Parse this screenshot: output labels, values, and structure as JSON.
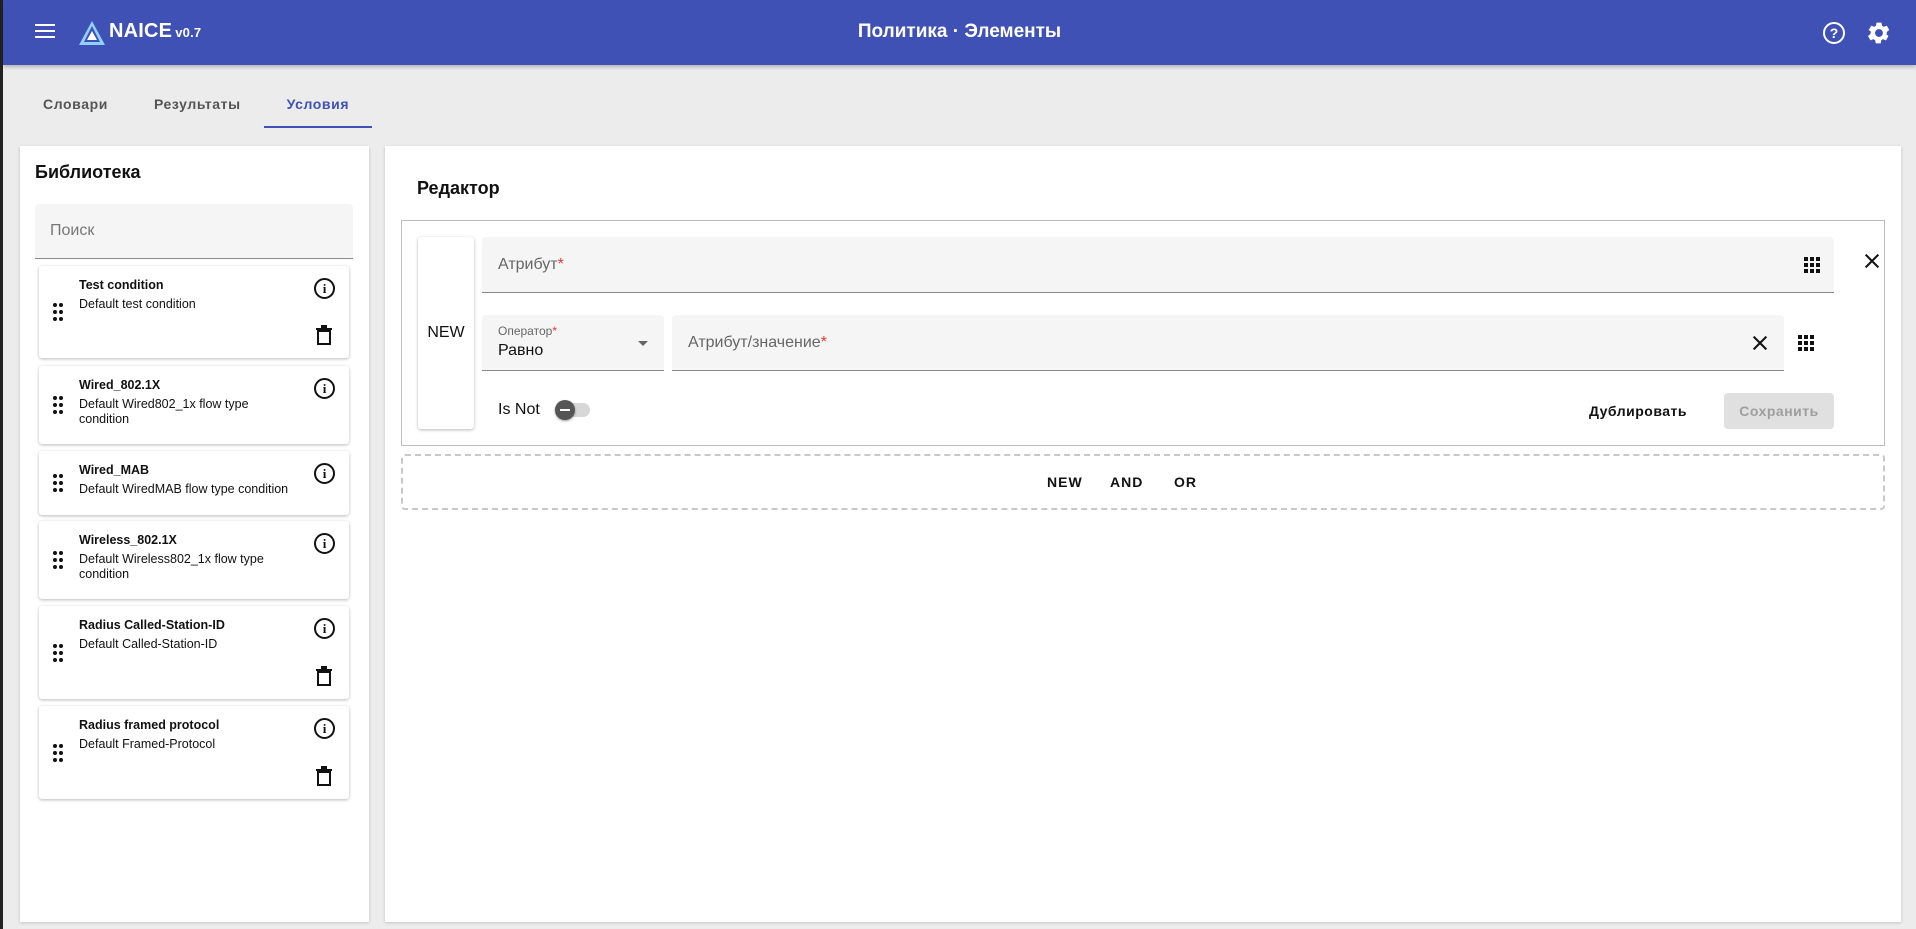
{
  "app": {
    "name": "NAICE",
    "version": "v0.7",
    "page_title": "Политика · Элементы"
  },
  "tabs": [
    {
      "label": "Словари"
    },
    {
      "label": "Результаты"
    },
    {
      "label": "Условия"
    }
  ],
  "active_tab": "Условия",
  "library": {
    "title": "Библиотека",
    "search_placeholder": "Поиск",
    "items": [
      {
        "name": "Test condition",
        "description": "Default test condition",
        "deletable": true
      },
      {
        "name": "Wired_802.1X",
        "description": "Default Wired802_1x flow type condition",
        "deletable": false
      },
      {
        "name": "Wired_MAB",
        "description": "Default WiredMAB flow type condition",
        "deletable": false
      },
      {
        "name": "Wireless_802.1X",
        "description": "Default Wireless802_1x flow type condition",
        "deletable": false
      },
      {
        "name": "Radius Called-Station-ID",
        "description": "Default Called-Station-ID",
        "deletable": true
      },
      {
        "name": "Radius framed protocol",
        "description": "Default Framed-Protocol",
        "deletable": true
      }
    ]
  },
  "editor": {
    "title": "Редактор",
    "condition": {
      "tag": "NEW",
      "attribute_label": "Атрибут",
      "operator_label": "Оператор",
      "operator_value": "Равно",
      "value_label": "Атрибут/значение",
      "required_mark": "*",
      "isnot_label": "Is Not",
      "isnot_enabled": false,
      "duplicate_label": "Дублировать",
      "save_label": "Сохранить"
    },
    "actions": {
      "new": "NEW",
      "and": "AND",
      "or": "OR"
    }
  },
  "colors": {
    "primary": "#3f51b5",
    "required": "#e53935",
    "background": "#ececec"
  }
}
